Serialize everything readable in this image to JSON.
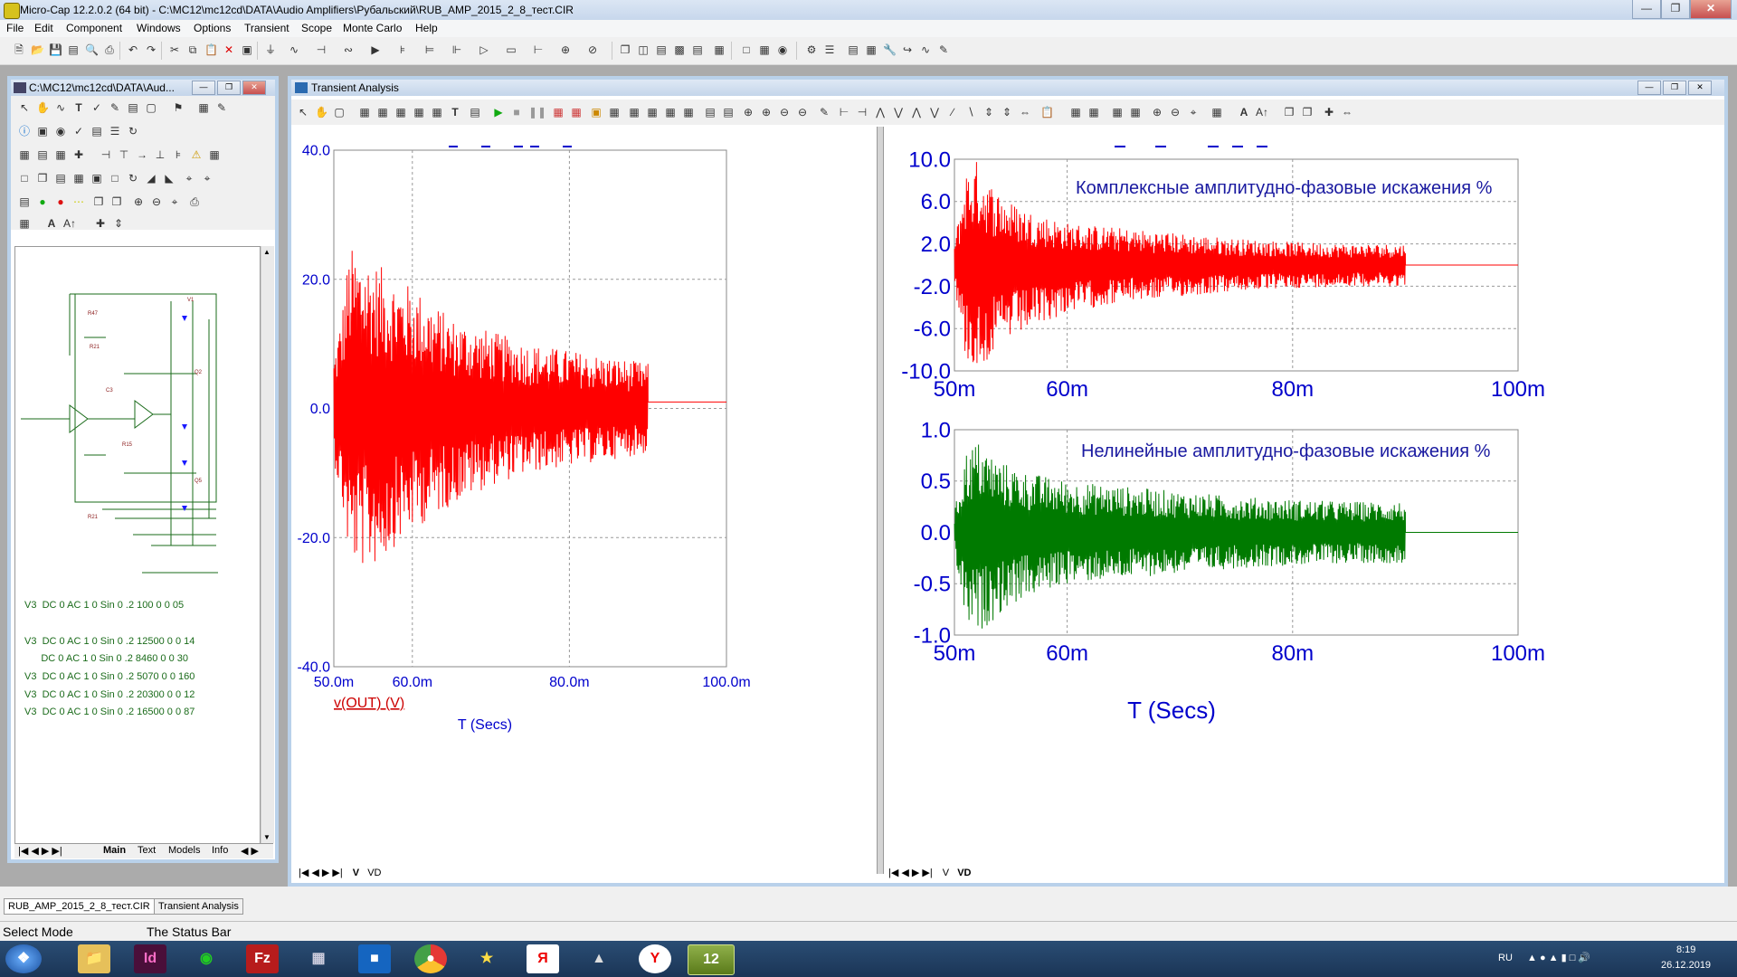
{
  "titlebar": {
    "title": "Micro-Cap 12.2.0.2 (64 bit) - C:\\MC12\\mc12cd\\DATA\\Audio Amplifiers\\Рубальский\\RUB_AMP_2015_2_8_тест.CIR"
  },
  "menu": [
    "File",
    "Edit",
    "Component",
    "Windows",
    "Options",
    "Transient",
    "Scope",
    "Monte Carlo",
    "Help"
  ],
  "schematic_window": {
    "title": "C:\\MC12\\mc12cd\\DATA\\Aud...",
    "netlist": [
      {
        "label": "V3",
        "text": "DC 0 AC 1 0 Sin 0 .2 100 0 0 05"
      },
      {
        "label": "V3",
        "text": "DC 0 AC 1 0 Sin 0 .2 12500 0 0 14"
      },
      {
        "label": "",
        "text": "DC 0 AC 1 0 Sin 0 .2 8460 0 0 30"
      },
      {
        "label": "V3",
        "text": "DC 0 AC 1 0 Sin 0 .2 5070 0 0 160"
      },
      {
        "label": "V3",
        "text": "DC 0 AC 1 0 Sin 0 .2 20300 0 0 12"
      },
      {
        "label": "V3",
        "text": "DC 0 AC 1 0 Sin 0 .2 16500 0 0 87"
      }
    ],
    "tabs": [
      "Main",
      "Text",
      "Models",
      "Info"
    ]
  },
  "transient_window": {
    "title": "Transient Analysis",
    "left_tabs": [
      "V",
      "VD"
    ],
    "right_tabs": [
      "V",
      "VD"
    ]
  },
  "colors": {
    "red_trace": "#ff0000",
    "green_trace": "#007a00",
    "axis_text": "#0000cc",
    "grid": "#888888"
  },
  "chart_data": [
    {
      "type": "line",
      "title": "",
      "xlabel": "T (Secs)",
      "legend": "v(OUT) (V)",
      "xlim": [
        50,
        100
      ],
      "ylim": [
        -40,
        40
      ],
      "x_ticks": [
        "50.0m",
        "60.0m",
        "80.0m",
        "100.0m"
      ],
      "y_ticks": [
        "40.0",
        "20.0",
        "0.0",
        "-20.0",
        "-40.0"
      ],
      "series": [
        {
          "name": "v(OUT) (V)",
          "color": "#ff0000",
          "envelope": {
            "x": [
              50,
              51,
              52,
              54,
              56,
              58,
              60,
              65,
              70,
              75,
              80,
              85,
              90,
              90.01,
              100
            ],
            "y_max": [
              8,
              15,
              25,
              24,
              22,
              20,
              19,
              14,
              12,
              10,
              9,
              8,
              7,
              1,
              1
            ],
            "y_min": [
              -8,
              -15,
              -24,
              -25,
              -24,
              -21,
              -19,
              -15,
              -12,
              -10,
              -9,
              -8,
              -7,
              1,
              1
            ]
          }
        }
      ]
    },
    {
      "type": "line",
      "title": "Комплексные амплитудно-фазовые искажения %",
      "xlabel": "",
      "xlim": [
        50,
        100
      ],
      "ylim": [
        -10,
        10
      ],
      "x_ticks": [
        "50m",
        "60m",
        "80m",
        "100m"
      ],
      "y_ticks": [
        "10.0",
        "6.0",
        "2.0",
        "-2.0",
        "-6.0",
        "-10.0"
      ],
      "series": [
        {
          "name": "",
          "color": "#ff0000",
          "envelope": {
            "x": [
              50,
              51,
              52,
              53,
              55,
              57,
              60,
              65,
              70,
              75,
              80,
              85,
              90,
              90.01,
              100
            ],
            "y_max": [
              2,
              9,
              10,
              8,
              6,
              5,
              4,
              3.5,
              3,
              2.5,
              2.2,
              2,
              2,
              0,
              0
            ],
            "y_min": [
              -2,
              -9,
              -10,
              -9,
              -7,
              -6,
              -4.5,
              -3.5,
              -3,
              -2.5,
              -2.2,
              -2,
              -2,
              0,
              0
            ]
          }
        }
      ]
    },
    {
      "type": "line",
      "title": "Нелинейные амплитудно-фазовые искажения %",
      "xlabel": "T (Secs)",
      "xlim": [
        50,
        100
      ],
      "ylim": [
        -1,
        1
      ],
      "x_ticks": [
        "50m",
        "60m",
        "80m",
        "100m"
      ],
      "y_ticks": [
        "1.0",
        "0.5",
        "0.0",
        "-0.5",
        "-1.0"
      ],
      "series": [
        {
          "name": "",
          "color": "#007a00",
          "envelope": {
            "x": [
              50,
              51,
              52,
              54,
              56,
              60,
              65,
              70,
              75,
              80,
              85,
              90,
              90.01,
              100
            ],
            "y_max": [
              0.2,
              0.8,
              0.9,
              0.7,
              0.6,
              0.5,
              0.45,
              0.4,
              0.35,
              0.32,
              0.3,
              0.3,
              0,
              0
            ],
            "y_min": [
              -0.2,
              -0.9,
              -1.0,
              -0.8,
              -0.65,
              -0.5,
              -0.45,
              -0.4,
              -0.35,
              -0.32,
              -0.3,
              -0.3,
              0,
              0
            ]
          }
        }
      ]
    }
  ],
  "doc_tabs": [
    "RUB_AMP_2015_2_8_тест.CIR",
    "Transient Analysis"
  ],
  "status": {
    "mode": "Select Mode",
    "bar": "The Status Bar"
  },
  "tray": {
    "lang": "RU",
    "time": "8:19",
    "date": "26.12.2019"
  }
}
